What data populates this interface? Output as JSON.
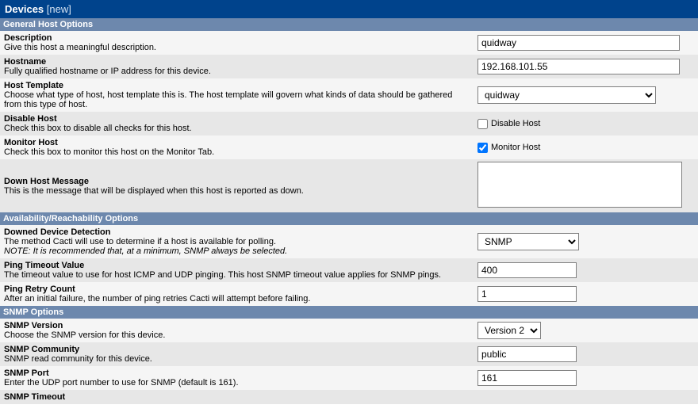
{
  "title": {
    "main": "Devices",
    "suffix": "[new]"
  },
  "sections": {
    "general": "General Host Options",
    "availability": "Availability/Reachability Options",
    "snmp": "SNMP Options"
  },
  "fields": {
    "description": {
      "label": "Description",
      "help": "Give this host a meaningful description.",
      "value": "quidway"
    },
    "hostname": {
      "label": "Hostname",
      "help": "Fully qualified hostname or IP address for this device.",
      "value": "192.168.101.55"
    },
    "host_template": {
      "label": "Host Template",
      "help": "Choose what type of host, host template this is. The host template will govern what kinds of data should be gathered from this type of host.",
      "value": "quidway"
    },
    "disable_host": {
      "label": "Disable Host",
      "help": "Check this box to disable all checks for this host.",
      "cb_label": "Disable Host",
      "checked": false
    },
    "monitor_host": {
      "label": "Monitor Host",
      "help": "Check this box to monitor this host on the Monitor Tab.",
      "cb_label": "Monitor Host",
      "checked": true
    },
    "down_host_message": {
      "label": "Down Host Message",
      "help": "This is the message that will be displayed when this host is reported as down.",
      "value": ""
    },
    "downed_detection": {
      "label": "Downed Device Detection",
      "help": "The method Cacti will use to determine if a host is available for polling.",
      "note": "NOTE: It is recommended that, at a minimum, SNMP always be selected.",
      "value": "SNMP"
    },
    "ping_timeout": {
      "label": "Ping Timeout Value",
      "help": "The timeout value to use for host ICMP and UDP pinging. This host SNMP timeout value applies for SNMP pings.",
      "value": "400"
    },
    "ping_retry": {
      "label": "Ping Retry Count",
      "help": "After an initial failure, the number of ping retries Cacti will attempt before failing.",
      "value": "1"
    },
    "snmp_version": {
      "label": "SNMP Version",
      "help": "Choose the SNMP version for this device.",
      "value": "Version 2"
    },
    "snmp_community": {
      "label": "SNMP Community",
      "help": "SNMP read community for this device.",
      "value": "public"
    },
    "snmp_port": {
      "label": "SNMP Port",
      "help": "Enter the UDP port number to use for SNMP (default is 161).",
      "value": "161"
    },
    "snmp_timeout": {
      "label": "SNMP Timeout"
    }
  }
}
